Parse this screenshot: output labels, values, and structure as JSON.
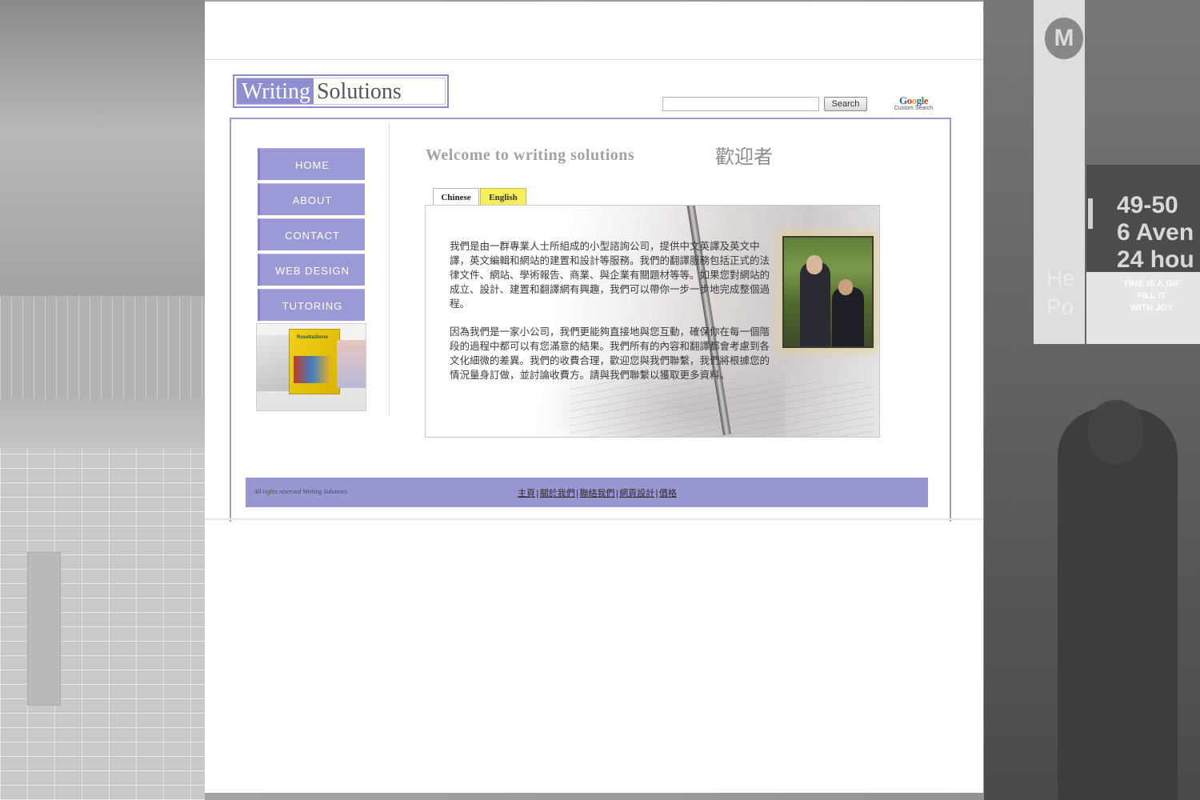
{
  "background": {
    "sign_text": "49-50\n6 Aven\n24 hou",
    "faint_text": "He\nPo",
    "ad_text": "TIME IS A GIF\nFILL IT\nWITH JOY"
  },
  "header": {
    "logo_part1": "Writing",
    "logo_part2": "Solutions",
    "search_placeholder": "",
    "search_button": "Search",
    "google_word": "Google",
    "google_sub": "Custom Search"
  },
  "nav": {
    "items": [
      {
        "label": "HOME"
      },
      {
        "label": "ABOUT"
      },
      {
        "label": "CONTACT"
      },
      {
        "label": "WEB DESIGN"
      },
      {
        "label": "TUTORING"
      }
    ]
  },
  "product": {
    "label": "RosettaStone"
  },
  "main": {
    "welcome": "Welcome to writing solutions",
    "welcome_cjk": "歡迎者",
    "tabs": [
      {
        "label": "Chinese",
        "active": true
      },
      {
        "label": "English",
        "active": false
      }
    ],
    "paragraph1": "我們是由一群專業人士所組成的小型諮詢公司，提供中文英譯及英文中譯，英文編輯和網站的建置和設計等服務。我們的翻譯服務包括正式的法律文件、網站、學術報告、商業、與企業有關題材等等。如果您對網站的成立、設計、建置和翻譯網有興趣，我們可以帶你一步一步地完成整個過程。",
    "paragraph2": "因為我們是一家小公司，我們更能夠直接地與您互動，確保你在每一個階段的過程中都可以有您滿意的結果。我們所有的內容和翻譯都會考慮到各文化細微的差異。我們的收費合理，歡迎您與我們聯繫，我們將根據您的情況量身訂做，並討論收費方。請與我們聯繫以獲取更多資料。"
  },
  "footer": {
    "copyright": "All rights reserved Writing Solutions",
    "links": [
      "主頁",
      "關於我們",
      "聯絡我們",
      "網頁設計",
      "價格"
    ],
    "separator": "|"
  },
  "colors": {
    "accent": "#9c9ad6",
    "tab_active_bg": "#ffffff",
    "tab_english_bg": "#f7ee5a",
    "footer_bg": "#9897d1"
  }
}
